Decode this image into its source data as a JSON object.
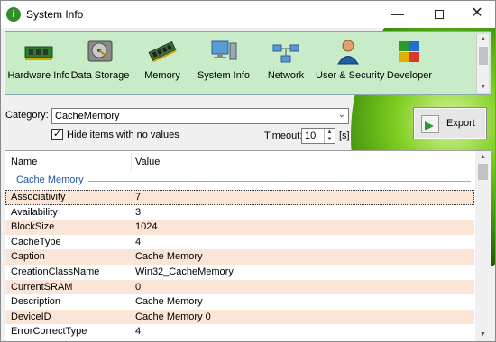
{
  "window": {
    "title": "System Info"
  },
  "toolbar": {
    "items": [
      {
        "label": "Hardware Info",
        "icon": "circuit-board-icon"
      },
      {
        "label": "Data Storage",
        "icon": "hard-drive-icon"
      },
      {
        "label": "Memory",
        "icon": "memory-module-icon"
      },
      {
        "label": "System Info",
        "icon": "computer-icon"
      },
      {
        "label": "Network",
        "icon": "network-icon"
      },
      {
        "label": "User & Security",
        "icon": "user-icon"
      },
      {
        "label": "Developer",
        "icon": "puzzle-icon"
      }
    ]
  },
  "category": {
    "label": "Category:",
    "selected": "CacheMemory"
  },
  "hide_empty": {
    "label": "Hide items with no values",
    "checked": true
  },
  "timeout": {
    "label": "Timeout:",
    "value": "10",
    "unit": "[s]"
  },
  "export": {
    "label": "Export"
  },
  "list": {
    "headers": {
      "name": "Name",
      "value": "Value"
    },
    "group": "Cache Memory",
    "rows": [
      {
        "name": "Associativity",
        "value": "7"
      },
      {
        "name": "Availability",
        "value": "3"
      },
      {
        "name": "BlockSize",
        "value": "1024"
      },
      {
        "name": "CacheType",
        "value": "4"
      },
      {
        "name": "Caption",
        "value": "Cache Memory"
      },
      {
        "name": "CreationClassName",
        "value": "Win32_CacheMemory"
      },
      {
        "name": "CurrentSRAM",
        "value": "0"
      },
      {
        "name": "Description",
        "value": "Cache Memory"
      },
      {
        "name": "DeviceID",
        "value": "Cache Memory 0"
      },
      {
        "name": "ErrorCorrectType",
        "value": "4"
      }
    ]
  }
}
